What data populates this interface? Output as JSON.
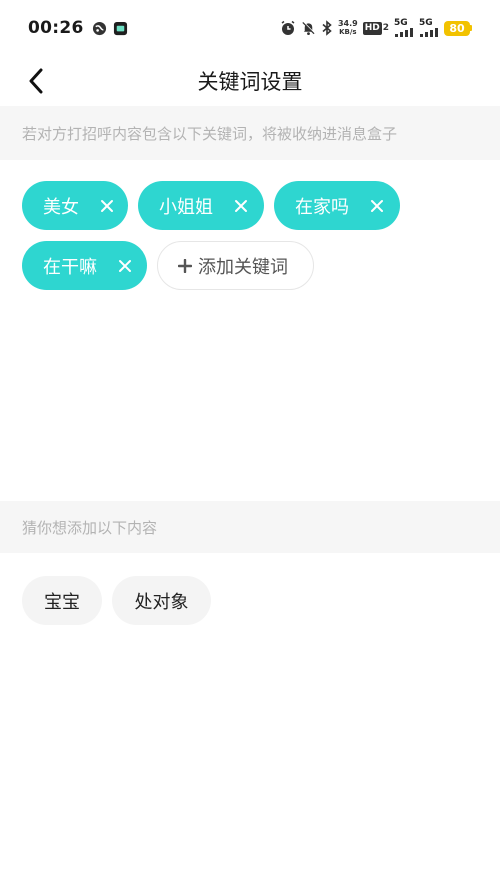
{
  "status_bar": {
    "time": "00:26",
    "net_speed_value": "34.9",
    "net_speed_unit": "KB/s",
    "hd_label": "HD",
    "hd_sub": "2",
    "sim1_label": "5G",
    "sim2_label": "5G",
    "battery": "80"
  },
  "header": {
    "title": "关键词设置"
  },
  "hint": "若对方打招呼内容包含以下关键词，将被收纳进消息盒子",
  "keywords": [
    {
      "label": "美女"
    },
    {
      "label": "小姐姐"
    },
    {
      "label": "在家吗"
    },
    {
      "label": "在干嘛"
    }
  ],
  "add_keyword_label": "添加关键词",
  "suggest_hint": "猜你想添加以下内容",
  "suggestions": [
    {
      "label": "宝宝"
    },
    {
      "label": "处对象"
    }
  ],
  "colors": {
    "accent": "#2ed6d0",
    "battery": "#f2c200",
    "hint_text": "#b3b3b3",
    "hint_bg": "#f6f6f6"
  }
}
